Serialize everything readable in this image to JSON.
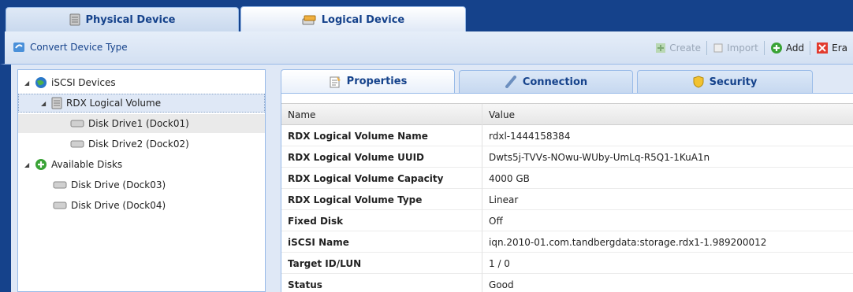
{
  "top_tabs": [
    {
      "label": "Physical Device",
      "icon": "server-icon"
    },
    {
      "label": "Logical Device",
      "icon": "disk-stack-icon"
    }
  ],
  "toolbar": {
    "convert_label": "Convert Device Type",
    "create_label": "Create",
    "import_label": "Import",
    "add_label": "Add",
    "erase_label": "Era"
  },
  "tree": {
    "iscsi_devices": "iSCSI Devices",
    "rdx_volume": "RDX Logical Volume",
    "disk1": "Disk Drive1 (Dock01)",
    "disk2": "Disk Drive2 (Dock02)",
    "available_disks": "Available Disks",
    "disk3": "Disk Drive (Dock03)",
    "disk4": "Disk Drive (Dock04)"
  },
  "sub_tabs": [
    {
      "label": "Properties",
      "icon": "properties-icon"
    },
    {
      "label": "Connection",
      "icon": "connection-icon"
    },
    {
      "label": "Security",
      "icon": "shield-icon"
    }
  ],
  "grid": {
    "col_name": "Name",
    "col_value": "Value",
    "rows": [
      {
        "name": "RDX Logical Volume Name",
        "value": "rdxl-1444158384"
      },
      {
        "name": "RDX Logical Volume UUID",
        "value": "Dwts5j-TVVs-NOwu-WUby-UmLq-R5Q1-1KuA1n"
      },
      {
        "name": "RDX Logical Volume Capacity",
        "value": "4000 GB"
      },
      {
        "name": "RDX Logical Volume Type",
        "value": "Linear"
      },
      {
        "name": "Fixed Disk",
        "value": "Off"
      },
      {
        "name": "iSCSI Name",
        "value": "iqn.2010-01.com.tandbergdata:storage.rdx1-1.989200012"
      },
      {
        "name": "Target ID/LUN",
        "value": "1 / 0"
      },
      {
        "name": "Status",
        "value": "Good"
      }
    ]
  },
  "colors": {
    "frame": "#15428b",
    "accent": "#99bbe8",
    "text": "#15428b"
  }
}
